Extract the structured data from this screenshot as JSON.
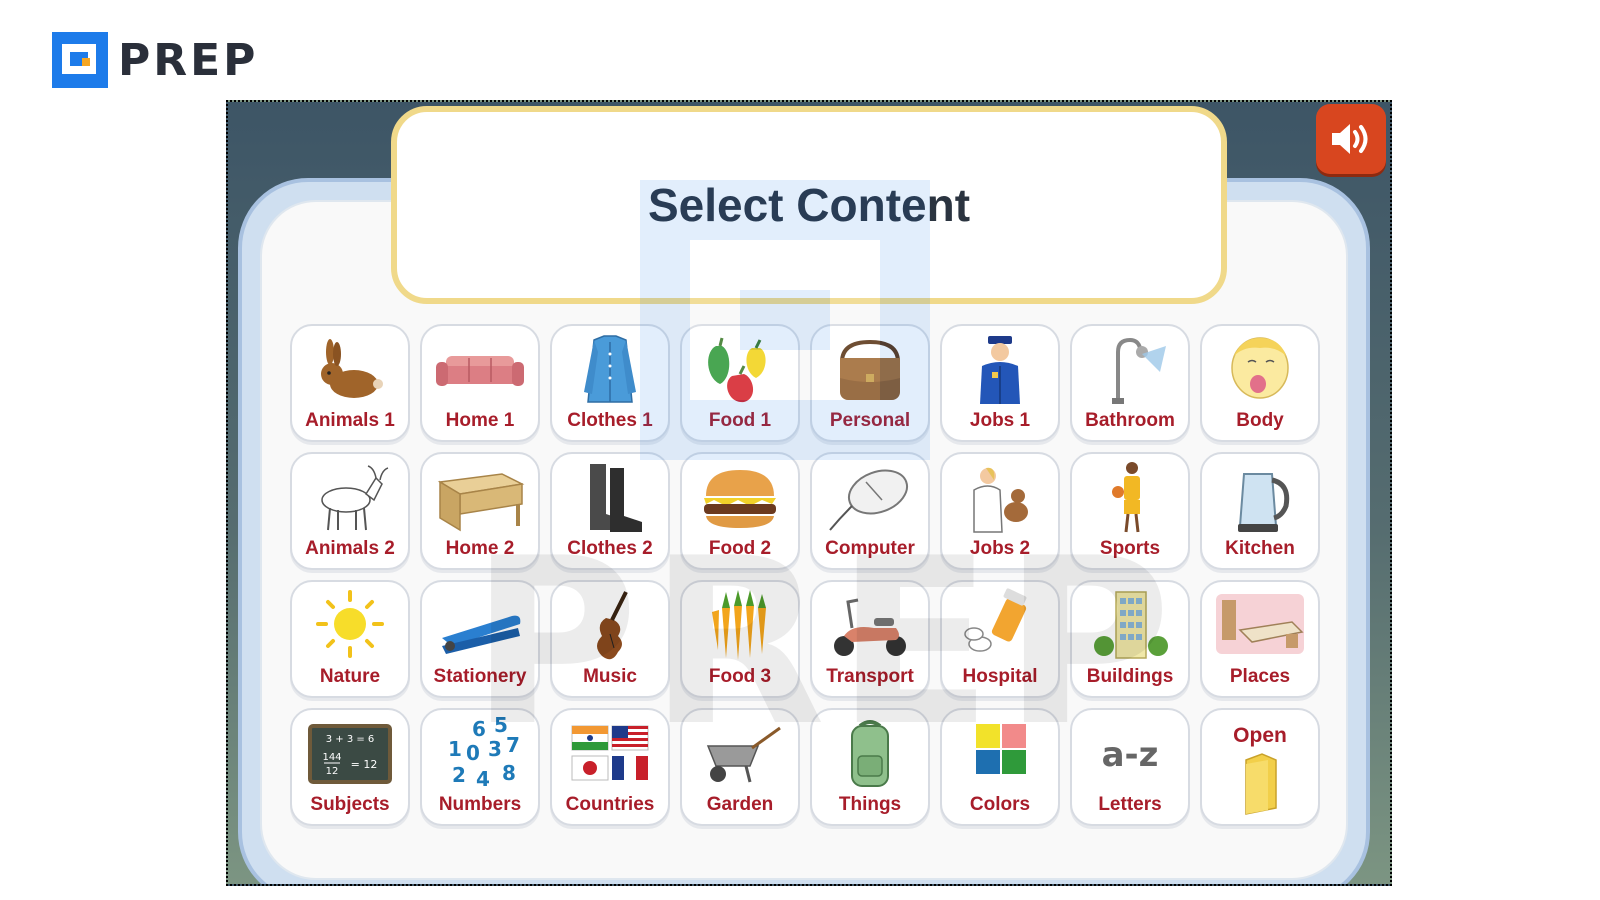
{
  "brand": {
    "name": "PREP",
    "accent": "#1d7bea"
  },
  "game": {
    "title": "Select Content",
    "sound_icon": "speaker-volume-icon",
    "colors": {
      "label": "#a71d2a",
      "title_border": "#f0d98a",
      "sound_button": "#d8461f"
    },
    "tiles": [
      {
        "label": "Animals 1",
        "icon": "rabbit-icon"
      },
      {
        "label": "Home 1",
        "icon": "sofa-icon"
      },
      {
        "label": "Clothes 1",
        "icon": "shirt-icon"
      },
      {
        "label": "Food 1",
        "icon": "peppers-icon"
      },
      {
        "label": "Personal",
        "icon": "bag-icon"
      },
      {
        "label": "Jobs 1",
        "icon": "police-officer-icon"
      },
      {
        "label": "Bathroom",
        "icon": "shower-icon"
      },
      {
        "label": "Body",
        "icon": "face-icon"
      },
      {
        "label": "Animals 2",
        "icon": "goat-icon"
      },
      {
        "label": "Home 2",
        "icon": "desk-icon"
      },
      {
        "label": "Clothes 2",
        "icon": "boots-icon"
      },
      {
        "label": "Food 2",
        "icon": "burger-icon"
      },
      {
        "label": "Computer",
        "icon": "mouse-icon"
      },
      {
        "label": "Jobs 2",
        "icon": "veterinarian-icon"
      },
      {
        "label": "Sports",
        "icon": "basketball-player-icon"
      },
      {
        "label": "Kitchen",
        "icon": "kettle-icon"
      },
      {
        "label": "Nature",
        "icon": "sun-icon"
      },
      {
        "label": "Stationery",
        "icon": "stapler-icon"
      },
      {
        "label": "Music",
        "icon": "violin-icon"
      },
      {
        "label": "Food 3",
        "icon": "carrots-icon"
      },
      {
        "label": "Transport",
        "icon": "scooter-icon"
      },
      {
        "label": "Hospital",
        "icon": "pills-icon"
      },
      {
        "label": "Buildings",
        "icon": "building-icon"
      },
      {
        "label": "Places",
        "icon": "bedroom-icon"
      },
      {
        "label": "Subjects",
        "icon": "chalkboard-icon"
      },
      {
        "label": "Numbers",
        "icon": "numbers-icon"
      },
      {
        "label": "Countries",
        "icon": "flags-icon"
      },
      {
        "label": "Garden",
        "icon": "wheelbarrow-icon"
      },
      {
        "label": "Things",
        "icon": "backpack-icon"
      },
      {
        "label": "Colors",
        "icon": "color-squares-icon"
      },
      {
        "label": "Letters",
        "icon": "a-z-icon"
      },
      {
        "label": "Open",
        "icon": "folder-icon"
      }
    ],
    "subjects_board": {
      "line1": "3 + 3 = 6",
      "line2": "144",
      "line3": "12",
      "line4": "= 12"
    },
    "numbers_digits": [
      "6",
      "5",
      "1",
      "0",
      "3",
      "7",
      "2",
      "4",
      "8"
    ],
    "letters_text": "a-z"
  },
  "watermark": {
    "text": "PREP"
  }
}
